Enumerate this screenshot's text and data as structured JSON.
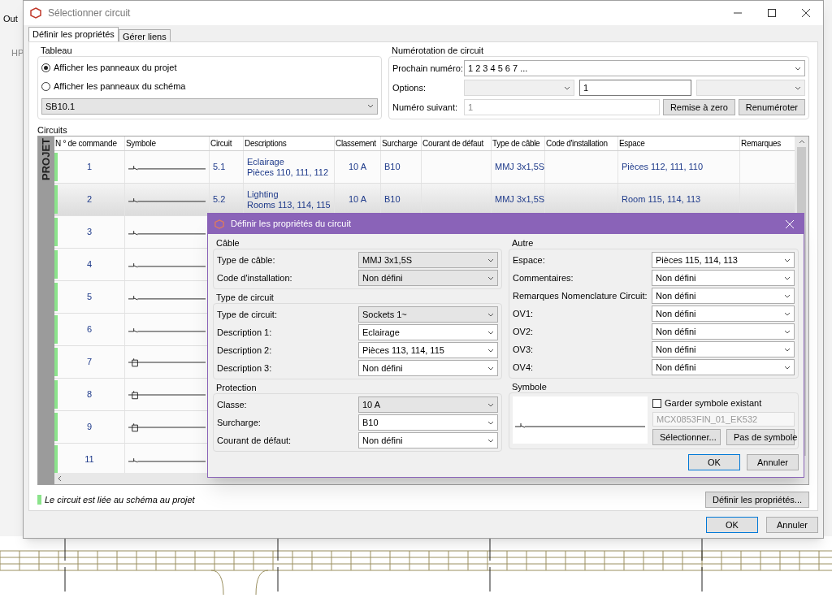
{
  "background_app": {
    "menu_text": "Out",
    "tab_text": "HP"
  },
  "window": {
    "title": "Sélectionner circuit"
  },
  "tabs": [
    {
      "label": "Définir les propriétés",
      "selected": true
    },
    {
      "label": "Gérer liens",
      "selected": false
    }
  ],
  "tableau": {
    "title": "Tableau",
    "options": [
      {
        "label": "Afficher les panneaux du projet",
        "selected": true
      },
      {
        "label": "Afficher les panneaux du schéma",
        "selected": false
      }
    ],
    "panel": "SB10.1"
  },
  "numerotation": {
    "title": "Numérotation de circuit",
    "next_label": "Prochain numéro:",
    "next_value": "1 2 3 4 5 6 7 ...",
    "options_label": "Options:",
    "options_value": "1",
    "following_label": "Numéro suivant:",
    "following_value": "1",
    "buttons": [
      "Remise à zero",
      "Renuméroter"
    ]
  },
  "circuits": {
    "title": "Circuits",
    "group_label": "PROJET",
    "columns": [
      "N ° de commande",
      "Symbole",
      "Circuit",
      "Descriptions",
      "Classement",
      "Surcharge",
      "Courant de défaut",
      "Type de câble",
      "Code d'installation",
      "Espace",
      "Remarques"
    ],
    "rows": [
      {
        "number": "1",
        "kind": "switch",
        "circuit": "5.1",
        "descriptions": [
          "Eclairage",
          "Pièces  110, 111, 112"
        ],
        "classement": "10  A",
        "surcharge": "B10",
        "cable": "MMJ 3x1,5S",
        "espace": "Pièces 112, 111, 110",
        "linked": true,
        "selected": false
      },
      {
        "number": "2",
        "kind": "switch",
        "circuit": "5.2",
        "descriptions": [
          "Lighting",
          "Rooms 113, 114, 115"
        ],
        "classement": "10  A",
        "surcharge": "B10",
        "cable": "MMJ 3x1,5S",
        "espace": "Room 115, 114, 113",
        "linked": true,
        "selected": true
      },
      {
        "number": "3",
        "kind": "switch",
        "linked": true,
        "selected": false
      },
      {
        "number": "4",
        "kind": "switch",
        "linked": true,
        "selected": false
      },
      {
        "number": "5",
        "kind": "switch",
        "linked": true,
        "selected": false
      },
      {
        "number": "6",
        "kind": "switch",
        "linked": true,
        "selected": false
      },
      {
        "number": "7",
        "kind": "box",
        "linked": true,
        "selected": false
      },
      {
        "number": "8",
        "kind": "box",
        "linked": true,
        "selected": false
      },
      {
        "number": "9",
        "kind": "box",
        "linked": true,
        "selected": false
      },
      {
        "number": "11",
        "kind": "switch",
        "linked": true,
        "selected": false
      }
    ]
  },
  "legend": "Le circuit est liée au schéma au projet",
  "define_button": "Définir les propriétés...",
  "buttons": [
    "OK",
    "Annuler"
  ],
  "dialog": {
    "title": "Définir les propriétés du circuit",
    "groups_left": [
      {
        "title": "Câble",
        "fields": [
          {
            "label": "Type de câble:",
            "value": "MMJ 3x1,5S",
            "editable": false
          },
          {
            "label": "Code d'installation:",
            "value": "Non défini",
            "editable": false
          }
        ]
      },
      {
        "title": "Type de circuit",
        "fields": [
          {
            "label": "Type de circuit:",
            "value": "Sockets 1~",
            "editable": false
          },
          {
            "label": "Description 1:",
            "value": "Eclairage",
            "editable": true
          },
          {
            "label": "Description 2:",
            "value": "Pièces 113, 114, 115",
            "editable": true
          },
          {
            "label": "Description 3:",
            "value": "Non défini",
            "editable": true
          }
        ]
      },
      {
        "title": "Protection",
        "fields": [
          {
            "label": "Classe:",
            "value": "10 A",
            "editable": false
          },
          {
            "label": "Surcharge:",
            "value": "B10",
            "editable": true
          },
          {
            "label": "Courant de défaut:",
            "value": "Non défini",
            "editable": true
          }
        ]
      }
    ],
    "groups_right": [
      {
        "title": "Autre",
        "fields": [
          {
            "label": "Espace:",
            "value": "Pièces 115, 114, 113",
            "editable": true
          },
          {
            "label": "Commentaires:",
            "value": "Non défini",
            "editable": true
          },
          {
            "label": "Remarques Nomenclature Circuit:",
            "value": "Non défini",
            "editable": true
          },
          {
            "label": "OV1:",
            "value": "Non défini",
            "editable": true
          },
          {
            "label": "OV2:",
            "value": "Non défini",
            "editable": true
          },
          {
            "label": "OV3:",
            "value": "Non défini",
            "editable": true
          },
          {
            "label": "OV4:",
            "value": "Non défini",
            "editable": true
          }
        ]
      }
    ],
    "symbol": {
      "title": "Symbole",
      "keep_label": "Garder symbole existant",
      "keep_checked": false,
      "name": "MCX0853FIN_01_EK532",
      "buttons": [
        "Sélectionner...",
        "Pas de symbole"
      ]
    },
    "buttons": [
      "OK",
      "Annuler"
    ]
  }
}
